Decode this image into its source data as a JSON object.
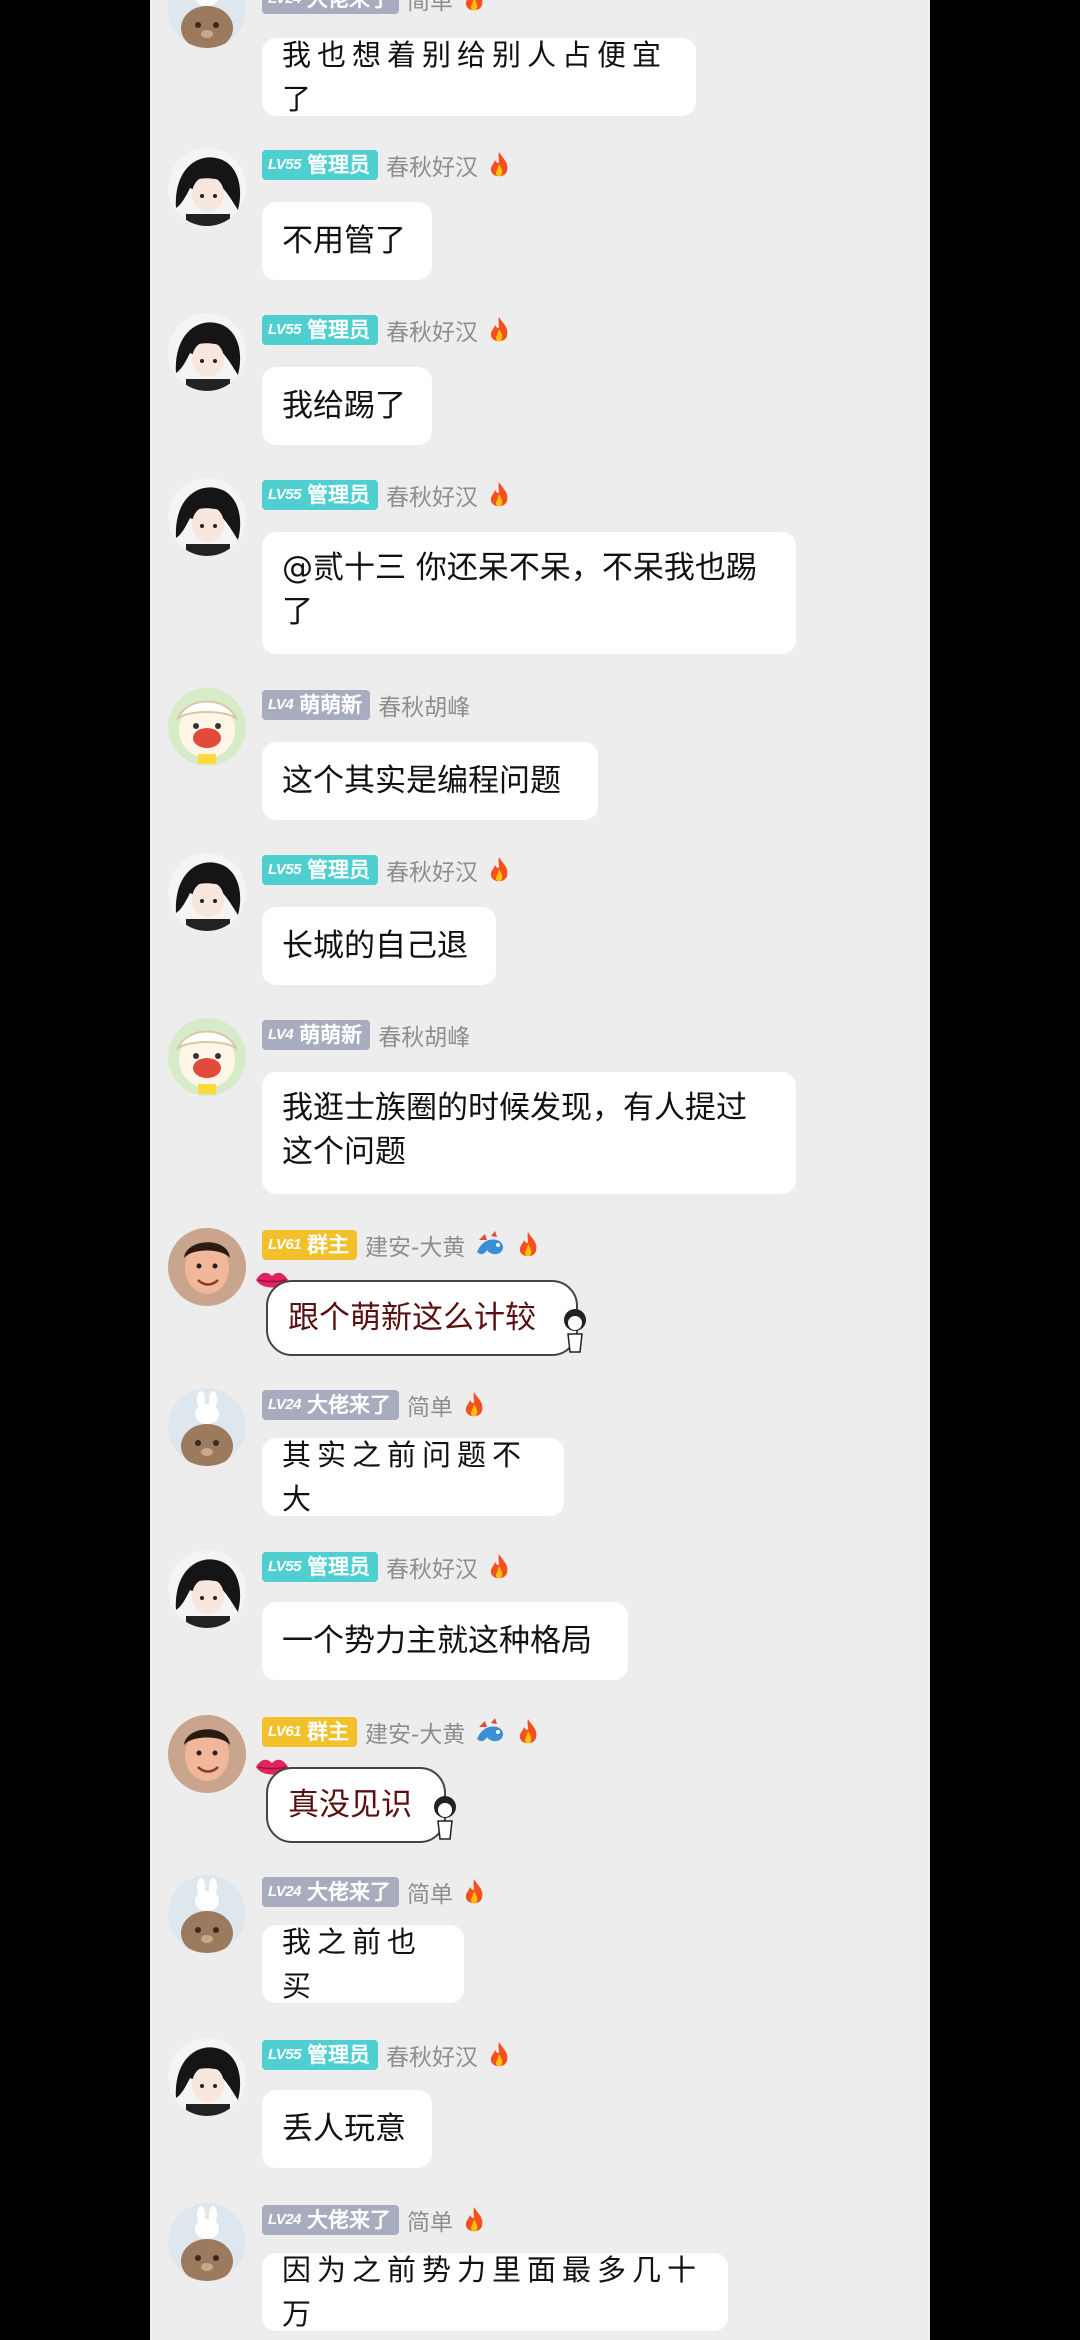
{
  "colors": {
    "teal_badge": "#4fcfcf",
    "gray_badge": "#a7adbe",
    "gold_badge": "#f2c02b",
    "chat_bg": "#ededed",
    "bubble_bg": "#ffffff"
  },
  "messages": [
    {
      "level": "LV24",
      "role": "大佬来了",
      "sender": "简单",
      "text": "我也想着别给别人占便宜了",
      "avatar": "bear-avatar"
    },
    {
      "level": "LV55",
      "role": "管理员",
      "sender": "春秋好汉",
      "text": "不用管了",
      "avatar": "anime-boy-avatar"
    },
    {
      "level": "LV55",
      "role": "管理员",
      "sender": "春秋好汉",
      "text": "我给踢了",
      "avatar": "anime-boy-avatar"
    },
    {
      "level": "LV55",
      "role": "管理员",
      "sender": "春秋好汉",
      "text": "@贰十三 你还呆不呆，不呆我也踢了",
      "avatar": "anime-boy-avatar"
    },
    {
      "level": "LV4",
      "role": "萌萌新",
      "sender": "春秋胡峰",
      "text": "这个其实是编程问题",
      "avatar": "cartoon-avatar"
    },
    {
      "level": "LV55",
      "role": "管理员",
      "sender": "春秋好汉",
      "text": "长城的自己退",
      "avatar": "anime-boy-avatar"
    },
    {
      "level": "LV4",
      "role": "萌萌新",
      "sender": "春秋胡峰",
      "text": "我逛士族圈的时候发现，有人提过这个问题",
      "avatar": "cartoon-avatar"
    },
    {
      "level": "LV61",
      "role": "群主",
      "sender": "建安-大黄",
      "text": "跟个萌新这么计较",
      "avatar": "man-avatar"
    },
    {
      "level": "LV24",
      "role": "大佬来了",
      "sender": "简单",
      "text": "其实之前问题不大",
      "avatar": "bear-avatar"
    },
    {
      "level": "LV55",
      "role": "管理员",
      "sender": "春秋好汉",
      "text": "一个势力主就这种格局",
      "avatar": "anime-boy-avatar"
    },
    {
      "level": "LV61",
      "role": "群主",
      "sender": "建安-大黄",
      "text": "真没见识",
      "avatar": "man-avatar"
    },
    {
      "level": "LV24",
      "role": "大佬来了",
      "sender": "简单",
      "text": "我之前也买",
      "avatar": "bear-avatar"
    },
    {
      "level": "LV55",
      "role": "管理员",
      "sender": "春秋好汉",
      "text": "丢人玩意",
      "avatar": "anime-boy-avatar"
    },
    {
      "level": "LV24",
      "role": "大佬来了",
      "sender": "简单",
      "text": "因为之前势力里面最多几十万",
      "avatar": "bear-avatar"
    }
  ]
}
